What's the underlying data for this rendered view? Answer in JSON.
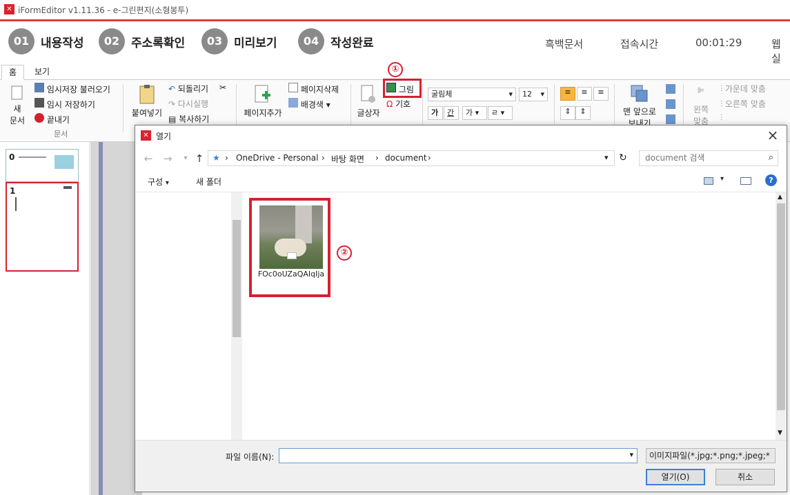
{
  "window": {
    "title": "iFormEditor v1.11.36 - e-그린편지(소형봉투)"
  },
  "steps": [
    {
      "num": "01",
      "label": "내용작성"
    },
    {
      "num": "02",
      "label": "주소록확인"
    },
    {
      "num": "03",
      "label": "미리보기"
    },
    {
      "num": "04",
      "label": "작성완료"
    }
  ],
  "topinfo": {
    "mode": "흑백문서",
    "conn_label": "접속시간",
    "timer": "00:01:29",
    "extra": "웹실"
  },
  "tabs": [
    "홈",
    "보기"
  ],
  "ribbon": {
    "doc": {
      "new_label": "새",
      "new_label2": "문서",
      "temp_load": "임시저장 불러오기",
      "temp_save": "임시 저장하기",
      "exit": "끝내기",
      "group": "문서"
    },
    "edit": {
      "paste": "붙여넣기",
      "undo": "되돌리기",
      "redo": "다시실행",
      "copy": "복사하기"
    },
    "page": {
      "add": "페이지추가",
      "delete": "페이지삭제",
      "bg": "배경색"
    },
    "insert": {
      "textbox": "글상자",
      "picture": "그림",
      "symbol": "기호"
    },
    "font": {
      "name": "굴림체",
      "size": "12",
      "bold": "가",
      "underline": "간",
      "color": "가",
      "highlight": "ㄹ"
    },
    "arrange": {
      "front_1": "맨 앞으로",
      "front_2": "보내기"
    },
    "align": {
      "left_1": "왼쪽",
      "left_2": "맞춤",
      "center": "가운데 맞춤",
      "right": "오른쪽 맞춤"
    }
  },
  "thumbs": [
    {
      "num": "0"
    },
    {
      "num": "1"
    }
  ],
  "dialog": {
    "title": "열기",
    "path": [
      "OneDrive - Personal",
      "바탕 화면",
      "document"
    ],
    "search_placeholder": "document 검색",
    "organize": "구성",
    "new_folder": "새 폴더",
    "files": [
      {
        "name": "FOc0oUZaQAIqIja"
      }
    ],
    "filename_label": "파일 이름(N):",
    "filename_value": "",
    "filetype": "이미지파일(*.jpg;*.png;*.jpeg;*",
    "open_button": "열기(O)",
    "cancel_button": "취소"
  },
  "markers": {
    "one": "①",
    "two": "②"
  },
  "colors": {
    "accent_red": "#d62030",
    "step_circle": "#8a8a8a",
    "titlebar_line": "#e23a3a"
  }
}
